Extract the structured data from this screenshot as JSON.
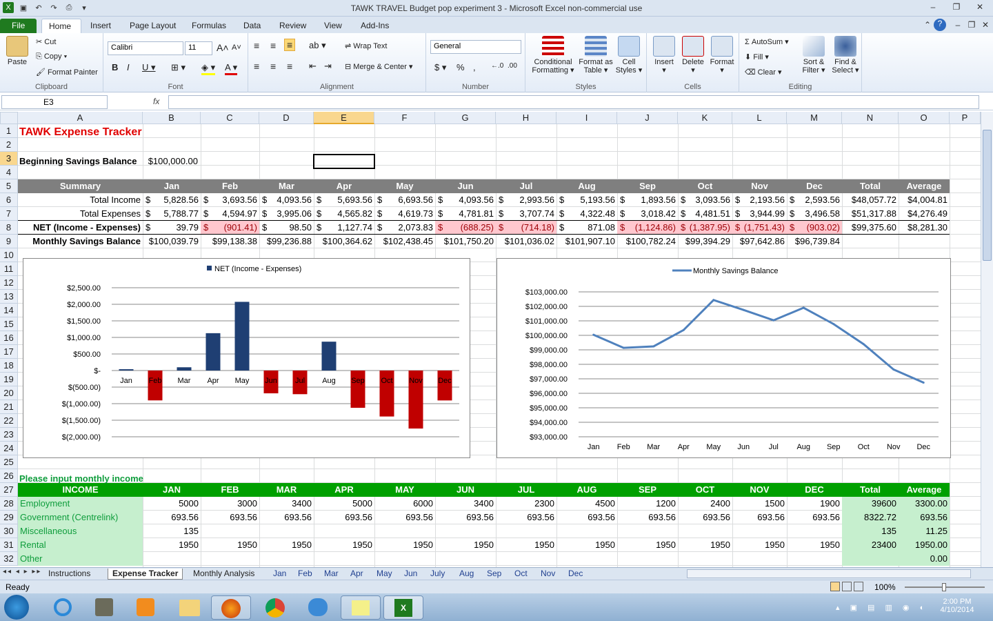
{
  "window": {
    "title": "TAWK TRAVEL Budget pop experiment 3  -  Microsoft Excel non-commercial use"
  },
  "tabs": [
    "File",
    "Home",
    "Insert",
    "Page Layout",
    "Formulas",
    "Data",
    "Review",
    "View",
    "Add-Ins"
  ],
  "ribbon": {
    "clipboard": {
      "label": "Clipboard",
      "paste": "Paste",
      "cut": "Cut",
      "copy": "Copy",
      "painter": "Format Painter"
    },
    "font": {
      "label": "Font",
      "name": "Calibri",
      "size": "11"
    },
    "alignment": {
      "label": "Alignment",
      "wrap": "Wrap Text",
      "merge": "Merge & Center"
    },
    "number": {
      "label": "Number",
      "format": "General"
    },
    "styles": {
      "label": "Styles",
      "cond": "Conditional Formatting",
      "table": "Format as Table",
      "cell": "Cell Styles"
    },
    "cells": {
      "label": "Cells",
      "insert": "Insert",
      "delete": "Delete",
      "format": "Format"
    },
    "editing": {
      "label": "Editing",
      "autosum": "AutoSum",
      "fill": "Fill",
      "clear": "Clear",
      "sort": "Sort & Filter",
      "find": "Find & Select"
    }
  },
  "namebox": "E3",
  "fx": "fx",
  "columns": [
    "A",
    "B",
    "C",
    "D",
    "E",
    "F",
    "G",
    "H",
    "I",
    "J",
    "K",
    "L",
    "M",
    "N",
    "O",
    "P"
  ],
  "rows": [
    "1",
    "2",
    "3",
    "4",
    "5",
    "6",
    "7",
    "8",
    "9",
    "10",
    "11",
    "12",
    "13",
    "14",
    "15",
    "16",
    "17",
    "18",
    "19",
    "20",
    "21",
    "22",
    "23",
    "24",
    "25",
    "26",
    "27",
    "28",
    "29",
    "30",
    "31",
    "32"
  ],
  "sheet": {
    "title": "TAWK Expense Tracker",
    "beg_label": "Beginning Savings Balance",
    "beg_value": "$100,000.00",
    "summary_headers": [
      "Summary",
      "Jan",
      "Feb",
      "Mar",
      "Apr",
      "May",
      "Jun",
      "Jul",
      "Aug",
      "Sep",
      "Oct",
      "Nov",
      "Dec",
      "Total",
      "Average"
    ],
    "income_row": {
      "label": "Total Income",
      "vals": [
        "5,828.56",
        "3,693.56",
        "4,093.56",
        "5,693.56",
        "6,693.56",
        "4,093.56",
        "2,993.56",
        "5,193.56",
        "1,893.56",
        "3,093.56",
        "2,193.56",
        "2,593.56"
      ],
      "total": "$48,057.72",
      "avg": "$4,004.81"
    },
    "expense_row": {
      "label": "Total Expenses",
      "vals": [
        "5,788.77",
        "4,594.97",
        "3,995.06",
        "4,565.82",
        "4,619.73",
        "4,781.81",
        "3,707.74",
        "4,322.48",
        "3,018.42",
        "4,481.51",
        "3,944.99",
        "3,496.58"
      ],
      "total": "$51,317.88",
      "avg": "$4,276.49"
    },
    "net_row": {
      "label": "NET (Income - Expenses)",
      "vals": [
        "39.79",
        "(901.41)",
        "98.50",
        "1,127.74",
        "2,073.83",
        "(688.25)",
        "(714.18)",
        "871.08",
        "(1,124.86)",
        "(1,387.95)",
        "(1,751.43)",
        "(903.02)"
      ],
      "total": "$99,375.60",
      "avg": "$8,281.30"
    },
    "savings_row": {
      "label": "Monthly Savings Balance",
      "vals": [
        "$100,039.79",
        "$99,138.38",
        "$99,236.88",
        "$100,364.62",
        "$102,438.45",
        "$101,750.20",
        "$101,036.02",
        "$101,907.10",
        "$100,782.24",
        "$99,394.29",
        "$97,642.86",
        "$96,739.84"
      ]
    },
    "input_title": "Please input monthly income",
    "income_headers": [
      "INCOME",
      "JAN",
      "FEB",
      "MAR",
      "APR",
      "MAY",
      "JUN",
      "JUL",
      "AUG",
      "SEP",
      "OCT",
      "NOV",
      "DEC",
      "Total",
      "Average"
    ],
    "income_table": [
      {
        "label": "Employment",
        "vals": [
          "5000",
          "3000",
          "3400",
          "5000",
          "6000",
          "3400",
          "2300",
          "4500",
          "1200",
          "2400",
          "1500",
          "1900"
        ],
        "total": "39600",
        "avg": "3300.00"
      },
      {
        "label": "Government (Centrelink)",
        "vals": [
          "693.56",
          "693.56",
          "693.56",
          "693.56",
          "693.56",
          "693.56",
          "693.56",
          "693.56",
          "693.56",
          "693.56",
          "693.56",
          "693.56"
        ],
        "total": "8322.72",
        "avg": "693.56"
      },
      {
        "label": "Miscellaneous",
        "vals": [
          "135",
          "",
          "",
          "",
          "",
          "",
          "",
          "",
          "",
          "",
          "",
          ""
        ],
        "total": "135",
        "avg": "11.25"
      },
      {
        "label": "Rental",
        "vals": [
          "1950",
          "1950",
          "1950",
          "1950",
          "1950",
          "1950",
          "1950",
          "1950",
          "1950",
          "1950",
          "1950",
          "1950"
        ],
        "total": "23400",
        "avg": "1950.00"
      },
      {
        "label": "Other",
        "vals": [
          "",
          "",
          "",
          "",
          "",
          "",
          "",
          "",
          "",
          "",
          "",
          ""
        ],
        "total": "",
        "avg": "0.00"
      }
    ]
  },
  "chart_data": [
    {
      "type": "bar",
      "legend": "NET (Income - Expenses)",
      "categories": [
        "Jan",
        "Feb",
        "Mar",
        "Apr",
        "May",
        "Jun",
        "Jul",
        "Aug",
        "Sep",
        "Oct",
        "Nov",
        "Dec"
      ],
      "values": [
        39.79,
        -901.41,
        98.5,
        1127.74,
        2073.83,
        -688.25,
        -714.18,
        871.08,
        -1124.86,
        -1387.95,
        -1751.43,
        -903.02
      ],
      "ylim": [
        -2000,
        2500
      ],
      "yticks": [
        "$2,500.00",
        "$2,000.00",
        "$1,500.00",
        "$1,000.00",
        "$500.00",
        "$-",
        "$(500.00)",
        "$(1,000.00)",
        "$(1,500.00)",
        "$(2,000.00)"
      ],
      "colors": {
        "pos": "#1f3f73",
        "neg": "#c00000"
      }
    },
    {
      "type": "line",
      "legend": "Monthly Savings Balance",
      "categories": [
        "Jan",
        "Feb",
        "Mar",
        "Apr",
        "May",
        "Jun",
        "Jul",
        "Aug",
        "Sep",
        "Oct",
        "Nov",
        "Dec"
      ],
      "values": [
        100039.79,
        99138.38,
        99236.88,
        100364.62,
        102438.45,
        101750.2,
        101036.02,
        101907.1,
        100782.24,
        99394.29,
        97642.86,
        96739.84
      ],
      "ylim": [
        93000,
        103000
      ],
      "yticks": [
        "$103,000.00",
        "$102,000.00",
        "$101,000.00",
        "$100,000.00",
        "$99,000.00",
        "$98,000.00",
        "$97,000.00",
        "$96,000.00",
        "$95,000.00",
        "$94,000.00",
        "$93,000.00"
      ],
      "color": "#4f81bd"
    }
  ],
  "sheet_tabs": [
    "Instructions",
    "Expense Tracker",
    "Monthly Analysis",
    "Jan",
    "Feb",
    "Mar",
    "Apr",
    "May",
    "Jun",
    "July",
    "Aug",
    "Sep",
    "Oct",
    "Nov",
    "Dec"
  ],
  "status": {
    "ready": "Ready",
    "zoom": "100%"
  },
  "clock": {
    "time": "2:00 PM",
    "date": "4/10/2014"
  }
}
